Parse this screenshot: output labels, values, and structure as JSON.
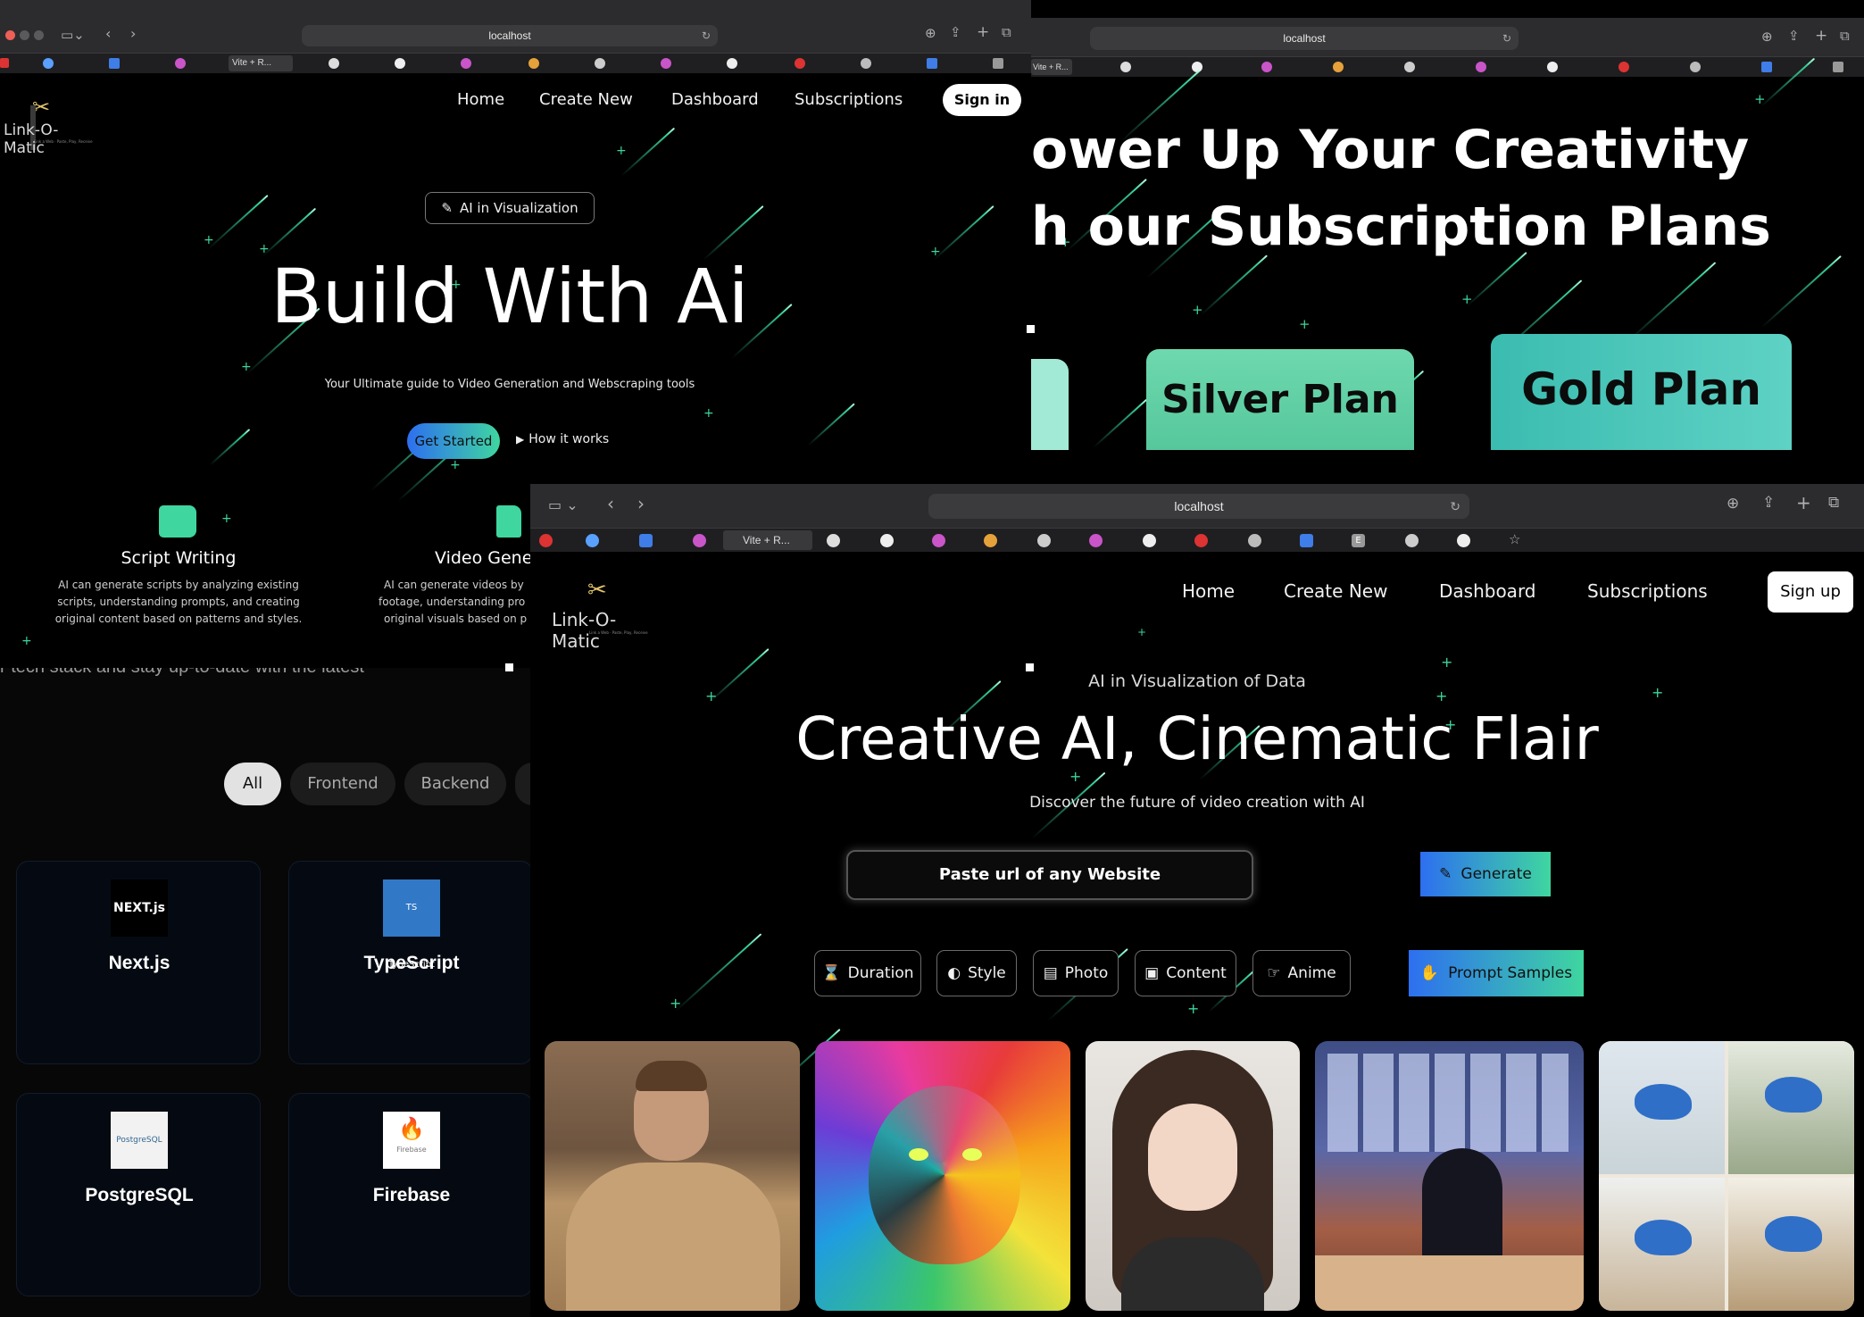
{
  "browser": {
    "url": "localhost",
    "active_tab_label": "Vite + R...",
    "tab_e_label": "E"
  },
  "home_pane": {
    "nav": {
      "home": "Home",
      "create_new": "Create New",
      "dashboard": "Dashboard",
      "subscriptions": "Subscriptions",
      "sign_in": "Sign in"
    },
    "logo": {
      "name": "Link-O-Matic",
      "tagline": "Link a Web · Paste, Play, Receive"
    },
    "badge": "AI in Visualization",
    "hero_title": "Build With Ai",
    "hero_subtitle": "Your Ultimate guide to Video Generation and Webscraping tools",
    "get_started": "Get Started",
    "how_it_works": "How it works",
    "features": [
      {
        "title": "Script Writing",
        "desc_lines": [
          "AI can generate scripts by analyzing existing",
          "scripts, understanding prompts, and creating",
          "original content based on patterns and styles."
        ],
        "icon": "scroll-icon"
      },
      {
        "title": "Video Gene",
        "desc_lines": [
          "AI can generate videos by",
          "footage, understanding pro",
          "original visuals based on p"
        ],
        "icon": "video-file-icon"
      }
    ]
  },
  "plans_pane": {
    "title_line1": "ower Up Your Creativity",
    "title_line2": "h our Subscription Plans",
    "plans": [
      "Silver Plan",
      "Gold Plan"
    ]
  },
  "tech_pane": {
    "partial_text": "r tech stack and stay up-to-date with the latest",
    "filters": [
      "All",
      "Frontend",
      "Backend"
    ],
    "cards": [
      {
        "name": "Next.js",
        "logo_text": "NEXT.js"
      },
      {
        "name": "TypeScript",
        "logo_text": "TS TypeScript"
      },
      {
        "name": "PostgreSQL",
        "logo_text": "PostgreSQL"
      },
      {
        "name": "Firebase",
        "logo_text": "Firebase"
      }
    ]
  },
  "create_pane": {
    "nav": {
      "home": "Home",
      "create_new": "Create New",
      "dashboard": "Dashboard",
      "subscriptions": "Subscriptions",
      "sign_up": "Sign up"
    },
    "logo": {
      "name": "Link-O-Matic",
      "tagline": "Link a Web · Paste, Play, Receive"
    },
    "eyebrow": "AI in Visualization of Data",
    "hero_title": "Creative AI, Cinematic Flair",
    "hero_subtitle": "Discover the future of video creation with AI",
    "url_input_placeholder": "Paste url of any Website",
    "generate": "Generate",
    "chips": [
      {
        "label": "Duration",
        "icon": "hourglass-icon"
      },
      {
        "label": "Style",
        "icon": "palette-icon"
      },
      {
        "label": "Photo",
        "icon": "photo-file-icon"
      },
      {
        "label": "Content",
        "icon": "save-icon"
      },
      {
        "label": "Anime",
        "icon": "hand-icon"
      }
    ],
    "prompt_samples": "Prompt Samples",
    "gallery": [
      "man-in-hoodie-photo",
      "colorful-tiger-art",
      "anime-girl-art",
      "anime-studio-scene",
      "bluebird-watercolors"
    ]
  },
  "colors": {
    "accent_teal": "#3cd69b",
    "gradient_start": "#2e6ff0",
    "gradient_end": "#3fd6a0",
    "silver_plan": "#5fd0a4",
    "gold_plan": "#4cc3b7"
  }
}
